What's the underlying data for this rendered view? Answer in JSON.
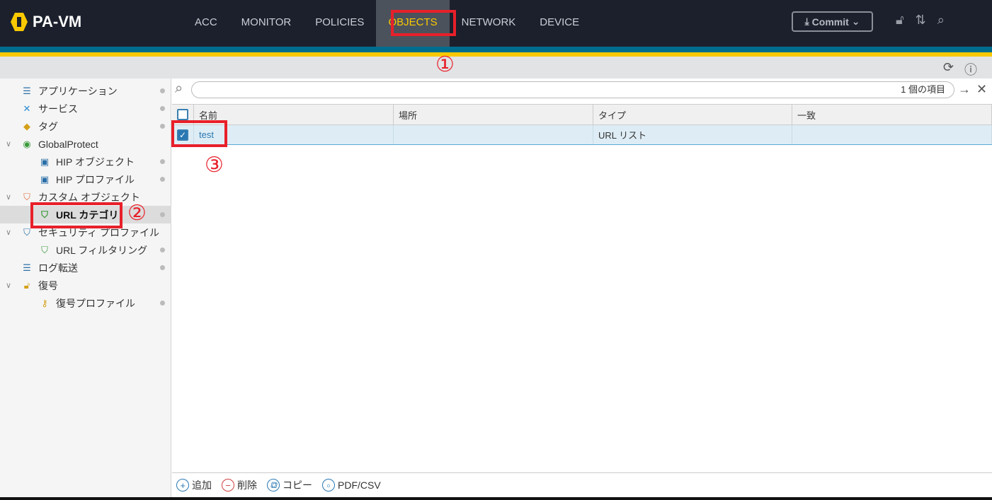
{
  "header": {
    "logo": "PA-VM",
    "nav": [
      "ACC",
      "MONITOR",
      "POLICIES",
      "OBJECTS",
      "NETWORK",
      "DEVICE"
    ],
    "active": "OBJECTS",
    "commit": "Commit"
  },
  "sidebar": {
    "items": [
      {
        "label": "アプリケーション"
      },
      {
        "label": "サービス"
      },
      {
        "label": "タグ"
      },
      {
        "label": "GlobalProtect"
      },
      {
        "label": "HIP オブジェクト"
      },
      {
        "label": "HIP プロファイル"
      },
      {
        "label": "カスタム オブジェクト"
      },
      {
        "label": "URL カテゴリ"
      },
      {
        "label": "セキュリティ プロファイル"
      },
      {
        "label": "URL フィルタリング"
      },
      {
        "label": "ログ転送"
      },
      {
        "label": "復号"
      },
      {
        "label": "復号プロファイル"
      }
    ]
  },
  "search": {
    "count": "1 個の項目"
  },
  "table": {
    "columns": [
      "名前",
      "場所",
      "タイプ",
      "一致"
    ],
    "rows": [
      {
        "name": "test",
        "location": "",
        "type": "URL リスト",
        "match": ""
      }
    ]
  },
  "footer": {
    "add": "追加",
    "delete": "削除",
    "copy": "コピー",
    "pdf": "PDF/CSV"
  },
  "annotations": [
    "①",
    "②",
    "③"
  ],
  "colors": {
    "accent": "#fac800",
    "teal": "#006d8f",
    "header": "#1b202c",
    "annotation": "#e8202a"
  }
}
